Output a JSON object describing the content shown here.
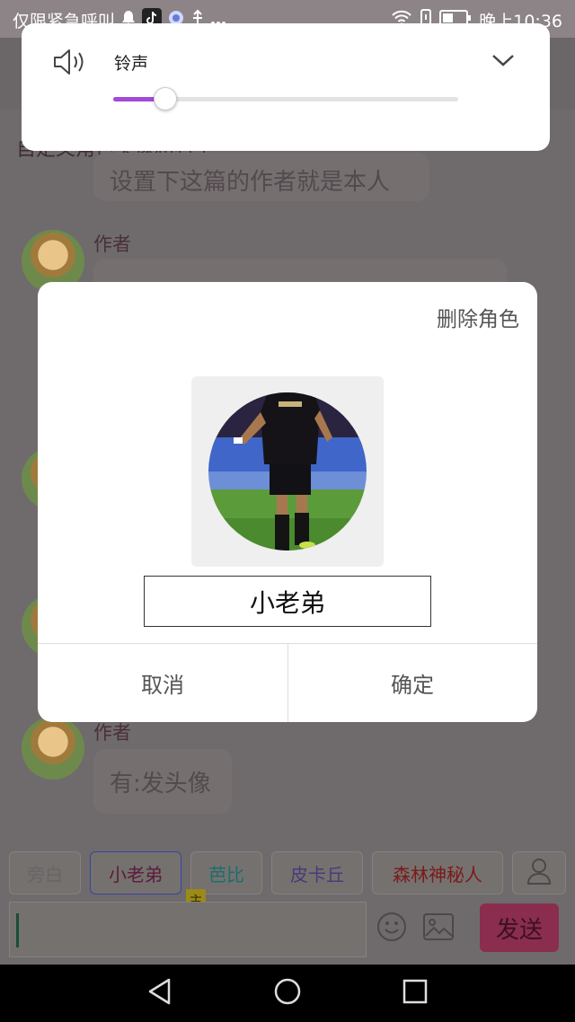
{
  "status_bar": {
    "carrier_text": "仅限紧急呼叫",
    "time": "晚上10:36"
  },
  "chat": {
    "top_text": "自定义角色头像和名字",
    "bubbles": [
      {
        "text": "设置下这篇的作者就是本人"
      },
      {
        "text": ""
      },
      {
        "text": "有:发头像"
      }
    ],
    "author_labels": [
      "作者",
      "作者"
    ]
  },
  "roles": {
    "items": [
      {
        "label": "旁白",
        "color": "#6a6466"
      },
      {
        "label": "小老弟",
        "color": "#5a1a3a"
      },
      {
        "label": "芭比",
        "color": "#1a6e70"
      },
      {
        "label": "皮卡丘",
        "color": "#4a3a7a"
      },
      {
        "label": "森林神秘人",
        "color": "#7a1a1a"
      }
    ],
    "main_tag": "主",
    "profile_icon": "person-icon"
  },
  "input": {
    "value": "",
    "send_label": "发送",
    "emoji_icon": "smiley-icon",
    "image_icon": "image-icon"
  },
  "nav": {
    "back_icon": "back-triangle-icon",
    "home_icon": "home-circle-icon",
    "recents_icon": "recents-square-icon"
  },
  "volume": {
    "label": "铃声",
    "level": 0.15,
    "accent": "#a34ad8",
    "speaker_icon": "speaker-icon",
    "chevron_icon": "chevron-down-icon"
  },
  "dialog": {
    "delete_label": "删除角色",
    "name_value": "小老弟",
    "cancel_label": "取消",
    "confirm_label": "确定",
    "avatar_icon": "football-player-avatar"
  }
}
